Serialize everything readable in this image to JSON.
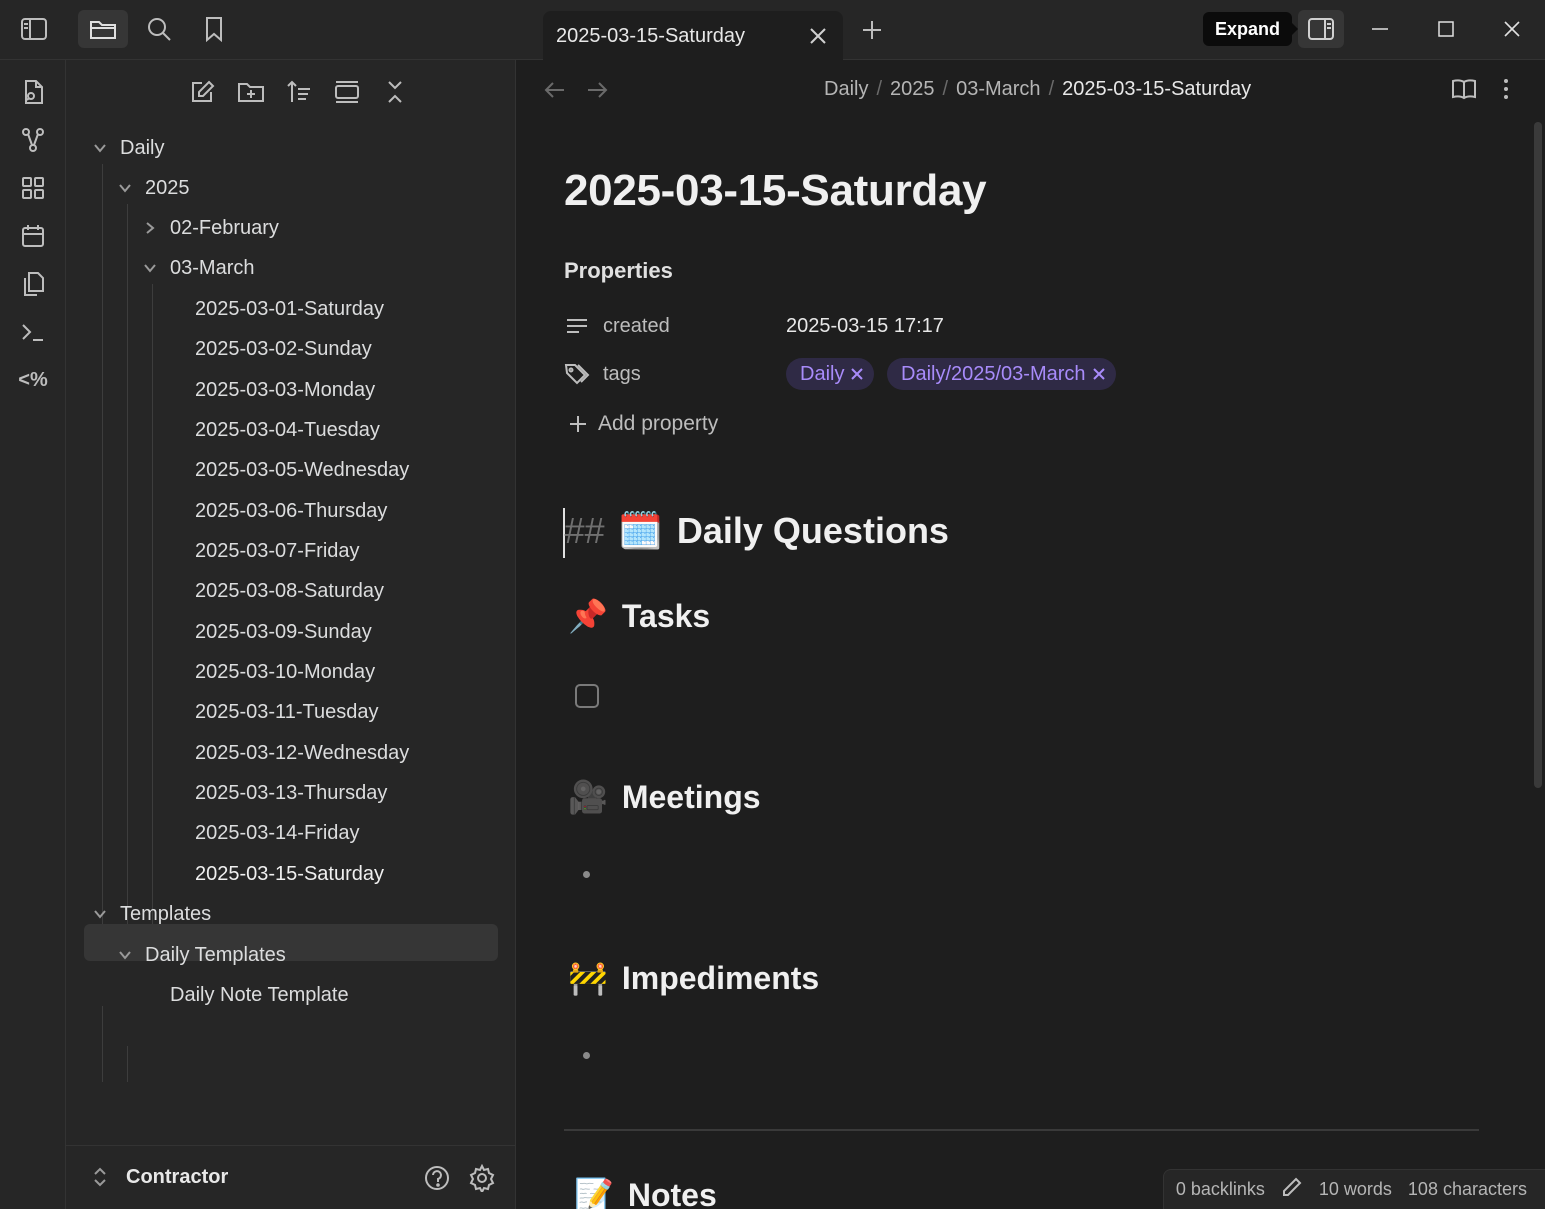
{
  "titlebar": {
    "tab_title": "2025-03-15-Saturday",
    "tooltip": "Expand"
  },
  "ribbon": {
    "icons": [
      "open-file-icon",
      "graph-view-icon",
      "canvas-icon",
      "calendar-icon",
      "files-icon",
      "command-palette-icon",
      "templater-icon"
    ],
    "templater_glyph": "<%"
  },
  "explorer": {
    "tree": {
      "daily": "Daily",
      "year": "2025",
      "february": "02-February",
      "march": "03-March",
      "notes": [
        "2025-03-01-Saturday",
        "2025-03-02-Sunday",
        "2025-03-03-Monday",
        "2025-03-04-Tuesday",
        "2025-03-05-Wednesday",
        "2025-03-06-Thursday",
        "2025-03-07-Friday",
        "2025-03-08-Saturday",
        "2025-03-09-Sunday",
        "2025-03-10-Monday",
        "2025-03-11-Tuesday",
        "2025-03-12-Wednesday",
        "2025-03-13-Thursday",
        "2025-03-14-Friday",
        "2025-03-15-Saturday"
      ],
      "selected_note": "2025-03-15-Saturday",
      "templates": "Templates",
      "daily_templates": "Daily Templates",
      "daily_note_template": "Daily Note Template"
    },
    "vault_name": "Contractor"
  },
  "editor": {
    "breadcrumb": [
      "Daily",
      "2025",
      "03-March",
      "2025-03-15-Saturday"
    ],
    "title": "2025-03-15-Saturday",
    "properties_heading": "Properties",
    "properties": {
      "created_key": "created",
      "created_value": "2025-03-15 17:17",
      "tags_key": "tags",
      "tags": [
        "Daily",
        "Daily/2025/03-March"
      ]
    },
    "add_property": "Add property",
    "h2_marker": "##",
    "h2_emoji": "🗓️",
    "h2_text": "Daily Questions",
    "sections": {
      "tasks": {
        "emoji": "📌",
        "text": "Tasks"
      },
      "meetings": {
        "emoji": "🎥",
        "text": "Meetings"
      },
      "impediments": {
        "emoji": "🚧",
        "text": "Impediments"
      },
      "notes": {
        "emoji": "📝",
        "text": "Notes"
      }
    }
  },
  "statusbar": {
    "backlinks": "0 backlinks",
    "words": "10 words",
    "characters": "108 characters"
  },
  "colors": {
    "background": "#1e1e1e",
    "panel": "#262626",
    "accent_tag_text": "#a88bfa",
    "accent_tag_bg": "#2f2a45"
  }
}
